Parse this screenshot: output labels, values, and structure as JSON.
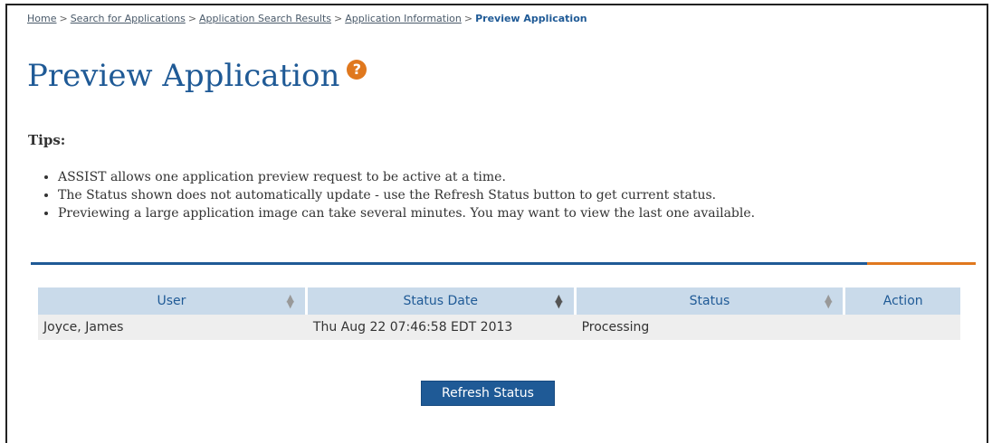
{
  "breadcrumb": {
    "items": [
      "Home",
      "Search for Applications",
      "Application Search Results",
      "Application Information"
    ],
    "current": "Preview Application",
    "separator": ">"
  },
  "page": {
    "title": "Preview Application",
    "help_icon": "question-mark-icon"
  },
  "tips": {
    "heading": "Tips:",
    "items": [
      "ASSIST allows one application preview request to be active at a time.",
      "The Status shown does not automatically update - use the Refresh Status button to get current status.",
      "Previewing a large application image can take several minutes.  You may want to view the last one available."
    ]
  },
  "table": {
    "columns": [
      "User",
      "Status Date",
      "Status",
      "Action"
    ],
    "rows": [
      {
        "user": "Joyce, James",
        "status_date": "Thu Aug 22 07:46:58 EDT 2013",
        "status": "Processing",
        "action": ""
      }
    ]
  },
  "actions": {
    "refresh_label": "Refresh Status"
  },
  "colors": {
    "primary": "#1f5a96",
    "accent": "#e0781e",
    "header_bg": "#c9daea",
    "row_bg": "#eeeeee"
  }
}
